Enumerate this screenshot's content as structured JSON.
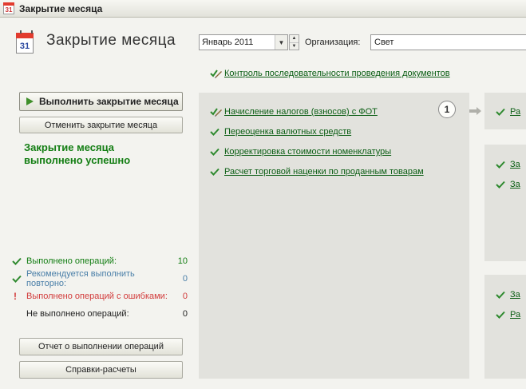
{
  "window": {
    "title": "Закрытие месяца",
    "icon_text": "31"
  },
  "header": {
    "title": "Закрытие месяца",
    "calendar_icon_text": "31",
    "period_value": "Январь 2011",
    "org_label": "Организация:",
    "org_value": "Свет"
  },
  "top_link": {
    "label": "Контроль последовательности проведения документов"
  },
  "actions": {
    "run_label": "Выполнить закрытие месяца",
    "cancel_label": "Отменить закрытие месяца",
    "success_line1": "Закрытие месяца",
    "success_line2": "выполнено успешно"
  },
  "stats": [
    {
      "label": "Выполнено операций:",
      "value": "10",
      "color": "#137e13"
    },
    {
      "label": "Рекомендуется выполнить повторно:",
      "value": "0",
      "color": "#4a7fa8"
    },
    {
      "label": "Выполнено операций с ошибками:",
      "value": "0",
      "color": "#d23b3b"
    },
    {
      "label": "Не выполнено операций:",
      "value": "0",
      "color": "#222222"
    }
  ],
  "bottom_buttons": {
    "report_label": "Отчет о выполнении операций",
    "calc_label": "Справки-расчеты"
  },
  "step1": {
    "number": "1",
    "items": [
      {
        "label": "Начисление налогов (взносов) с ФОТ",
        "icon": "pencil-check-icon"
      },
      {
        "label": "Переоценка валютных средств",
        "icon": "check-icon"
      },
      {
        "label": "Корректировка стоимости номенклатуры",
        "icon": "check-icon"
      },
      {
        "label": "Расчет торговой наценки по проданным товарам",
        "icon": "check-icon"
      }
    ]
  },
  "right_panels": {
    "p1": [
      "Ра"
    ],
    "p2": [
      "За",
      "За"
    ],
    "p3": [
      "За",
      "Ра"
    ]
  },
  "colors": {
    "accent_green": "#137e13",
    "link_green": "#0b5e14",
    "panel_bg": "#e2e2dd"
  }
}
